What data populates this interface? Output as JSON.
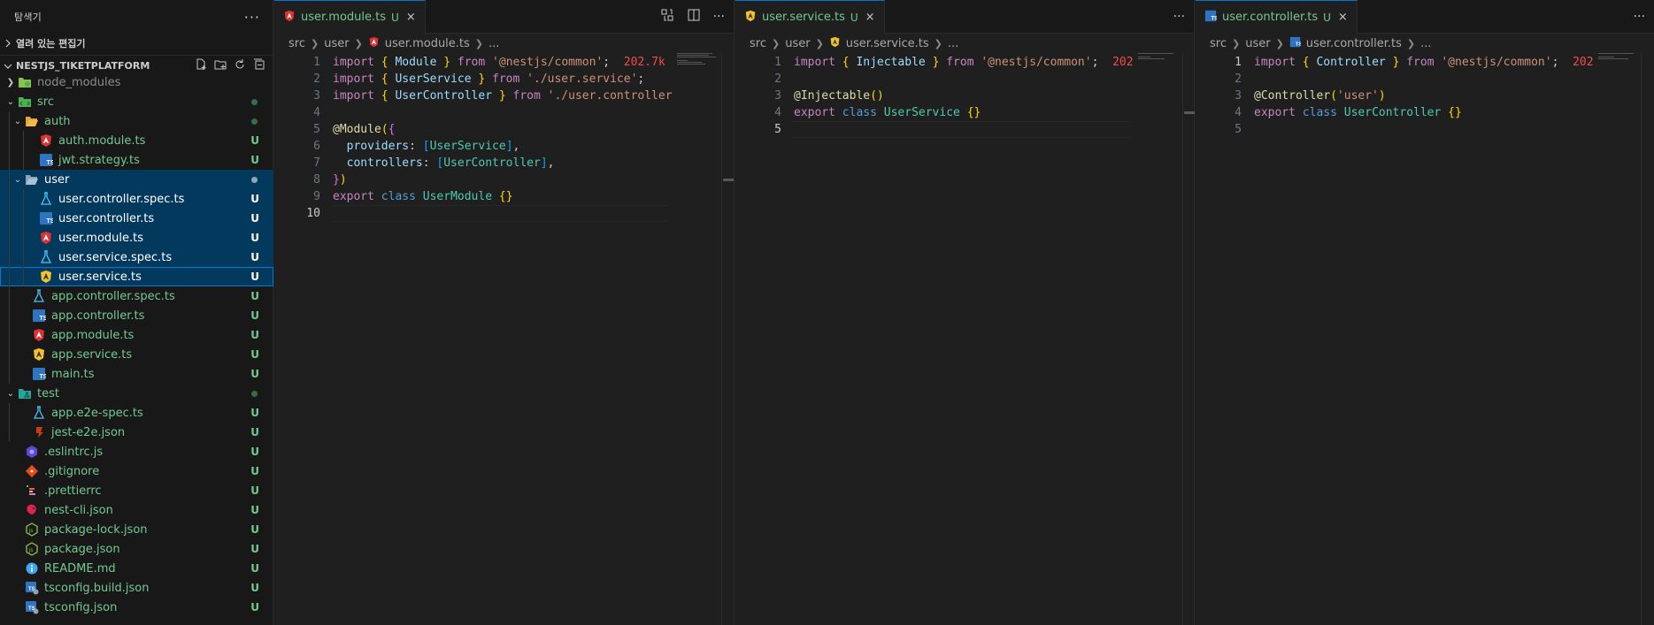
{
  "explorer": {
    "title": "탐색기",
    "open_editors": "열려 있는 편집기",
    "project": "NESTJS_TIKETPLATFORM",
    "more": "···",
    "items": [
      {
        "label": "node_modules",
        "badge": ""
      },
      {
        "label": "src",
        "badge": ""
      },
      {
        "label": "auth",
        "badge": ""
      },
      {
        "label": "auth.module.ts",
        "badge": "U"
      },
      {
        "label": "jwt.strategy.ts",
        "badge": "U"
      },
      {
        "label": "user",
        "badge": ""
      },
      {
        "label": "user.controller.spec.ts",
        "badge": "U"
      },
      {
        "label": "user.controller.ts",
        "badge": "U"
      },
      {
        "label": "user.module.ts",
        "badge": "U"
      },
      {
        "label": "user.service.spec.ts",
        "badge": "U"
      },
      {
        "label": "user.service.ts",
        "badge": "U"
      },
      {
        "label": "app.controller.spec.ts",
        "badge": "U"
      },
      {
        "label": "app.controller.ts",
        "badge": "U"
      },
      {
        "label": "app.module.ts",
        "badge": "U"
      },
      {
        "label": "app.service.ts",
        "badge": "U"
      },
      {
        "label": "main.ts",
        "badge": "U"
      },
      {
        "label": "test",
        "badge": ""
      },
      {
        "label": "app.e2e-spec.ts",
        "badge": "U"
      },
      {
        "label": "jest-e2e.json",
        "badge": "U"
      },
      {
        "label": ".eslintrc.js",
        "badge": "U"
      },
      {
        "label": ".gitignore",
        "badge": "U"
      },
      {
        "label": ".prettierrc",
        "badge": "U"
      },
      {
        "label": "nest-cli.json",
        "badge": "U"
      },
      {
        "label": "package-lock.json",
        "badge": "U"
      },
      {
        "label": "package.json",
        "badge": "U"
      },
      {
        "label": "README.md",
        "badge": "U"
      },
      {
        "label": "tsconfig.build.json",
        "badge": "U"
      },
      {
        "label": "tsconfig.json",
        "badge": "U"
      }
    ]
  },
  "editors": [
    {
      "tab": "user.module.ts",
      "badge": "U",
      "close": "×",
      "more": "···",
      "crumbs": [
        "src",
        "user",
        "user.module.ts",
        "..."
      ],
      "line_numbers": [
        "1",
        "2",
        "3",
        "4",
        "5",
        "6",
        "7",
        "8",
        "9",
        "10"
      ],
      "code": {
        "l1_import": "import",
        "l1_ob": "{",
        "l1_id": "Module",
        "l1_cb": "}",
        "l1_from": "from",
        "l1_str": "'@nestjs/common'",
        "l1_semi": ";",
        "l1_size": "202.7k",
        "l2_import": "import",
        "l2_ob": "{",
        "l2_id": "UserService",
        "l2_cb": "}",
        "l2_from": "from",
        "l2_str": "'./user.service'",
        "l2_semi": ";",
        "l3_import": "import",
        "l3_ob": "{",
        "l3_id": "UserController",
        "l3_cb": "}",
        "l3_from": "from",
        "l3_str": "'./user.controller",
        "l5_dec": "@Module",
        "l5_op": "(",
        "l5_ob": "{",
        "l6_key": "providers",
        "l6_colon": ":",
        "l6_ob": "[",
        "l6_id": "UserService",
        "l6_cb": "]",
        "l6_comma": ",",
        "l7_key": "controllers",
        "l7_colon": ":",
        "l7_ob": "[",
        "l7_id": "UserController",
        "l7_cb": "]",
        "l7_comma": ",",
        "l8_cb": "}",
        "l8_cp": ")",
        "l9_export": "export",
        "l9_class": "class",
        "l9_id": "UserModule",
        "l9_br": "{}"
      }
    },
    {
      "tab": "user.service.ts",
      "badge": "U",
      "close": "×",
      "more": "···",
      "crumbs": [
        "src",
        "user",
        "user.service.ts",
        "..."
      ],
      "line_numbers": [
        "1",
        "2",
        "3",
        "4",
        "5"
      ],
      "code": {
        "l1_import": "import",
        "l1_ob": "{",
        "l1_id": "Injectable",
        "l1_cb": "}",
        "l1_from": "from",
        "l1_str": "'@nestjs/common'",
        "l1_semi": ";",
        "l1_size": "202",
        "l3_dec": "@Injectable",
        "l3_br": "()",
        "l4_export": "export",
        "l4_class": "class",
        "l4_id": "UserService",
        "l4_br": "{}"
      }
    },
    {
      "tab": "user.controller.ts",
      "badge": "U",
      "close": "×",
      "more": "···",
      "crumbs": [
        "src",
        "user",
        "user.controller.ts",
        "..."
      ],
      "line_numbers": [
        "1",
        "2",
        "3",
        "4",
        "5"
      ],
      "code": {
        "l1_import": "import",
        "l1_ob": "{",
        "l1_id": "Controller",
        "l1_cb": "}",
        "l1_from": "from",
        "l1_str": "'@nestjs/common'",
        "l1_semi": ";",
        "l1_size": "202",
        "l3_dec": "@Controller",
        "l3_op": "(",
        "l3_str": "'user'",
        "l3_cp": ")",
        "l4_export": "export",
        "l4_class": "class",
        "l4_id": "UserController",
        "l4_br": "{}"
      }
    }
  ]
}
